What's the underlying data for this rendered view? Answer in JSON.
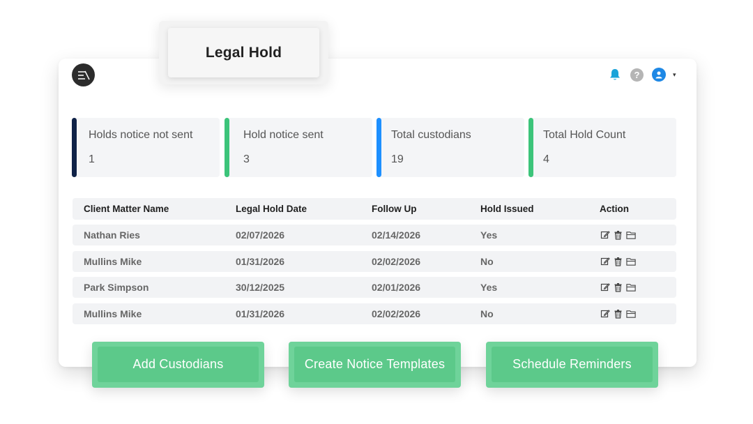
{
  "app": {
    "title": "Legal Hold"
  },
  "header": {
    "icons": [
      "menu-logo-icon",
      "bell-icon",
      "help-icon",
      "user-avatar-icon",
      "caret-down-icon"
    ],
    "help_glyph": "?",
    "caret_glyph": "▾"
  },
  "colors": {
    "bell": "#1aa3d9",
    "avatar": "#1e88e5",
    "accent_navy": "#0f2247",
    "accent_green": "#3cc47a",
    "accent_blue": "#1e90ff",
    "button": "#5cc98a"
  },
  "stats": [
    {
      "label": "Holds notice not sent",
      "value": "1",
      "color": "#0f2247"
    },
    {
      "label": "Hold notice sent",
      "value": "3",
      "color": "#3cc47a"
    },
    {
      "label": "Total custodians",
      "value": "19",
      "color": "#1e90ff"
    },
    {
      "label": "Total Hold Count",
      "value": "4",
      "color": "#3cc47a"
    }
  ],
  "table": {
    "columns": [
      "Client Matter Name",
      "Legal Hold Date",
      "Follow Up",
      "Hold Issued",
      "Action"
    ],
    "rows": [
      {
        "name": "Nathan Ries",
        "hold_date": "02/07/2026",
        "follow_up": "02/14/2026",
        "issued": "Yes"
      },
      {
        "name": "Mullins Mike",
        "hold_date": "01/31/2026",
        "follow_up": "02/02/2026",
        "issued": "No"
      },
      {
        "name": "Park Simpson",
        "hold_date": "30/12/2025",
        "follow_up": "02/01/2026",
        "issued": "Yes"
      },
      {
        "name": "Mullins Mike",
        "hold_date": "01/31/2026",
        "follow_up": "02/02/2026",
        "issued": "No"
      }
    ],
    "action_icons": [
      "edit-icon",
      "trash-icon",
      "folder-icon"
    ]
  },
  "buttons": {
    "add_custodians": "Add Custodians",
    "create_templates": "Create Notice Templates",
    "schedule_reminders": "Schedule Reminders"
  }
}
